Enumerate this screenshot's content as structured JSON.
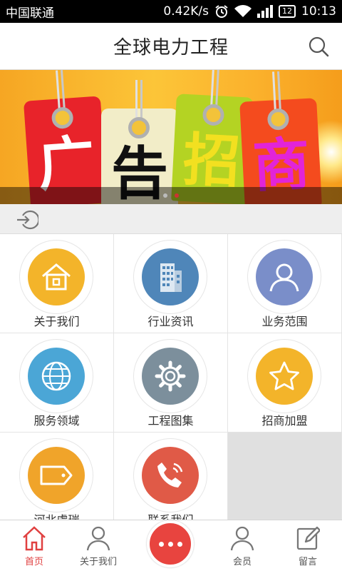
{
  "status_bar": {
    "carrier": "中国联通",
    "speed": "0.42K/s",
    "battery": "12",
    "time": "10:13"
  },
  "header": {
    "title": "全球电力工程",
    "search_icon": "search-icon"
  },
  "banner": {
    "tags": [
      {
        "char": "广",
        "bg": "#e8232a",
        "color": "#ffffff"
      },
      {
        "char": "告",
        "bg": "#f2edc8",
        "color": "#111111"
      },
      {
        "char": "招",
        "bg": "#b4d323",
        "color": "#f2e020"
      },
      {
        "char": "商",
        "bg": "#f44b1e",
        "color": "#e224d8"
      }
    ],
    "slide_count": 2,
    "active_slide": 2
  },
  "login_strip": {
    "icon": "login-icon"
  },
  "menu": [
    {
      "label": "关于我们",
      "icon": "home-icon",
      "color": "#f3b42a"
    },
    {
      "label": "行业资讯",
      "icon": "building-icon",
      "color": "#4f86b9"
    },
    {
      "label": "业务范围",
      "icon": "person-icon",
      "color": "#7a8ec9"
    },
    {
      "label": "服务领域",
      "icon": "globe-icon",
      "color": "#4ba6d6"
    },
    {
      "label": "工程图集",
      "icon": "gear-icon",
      "color": "#7c8f9c"
    },
    {
      "label": "招商加盟",
      "icon": "star-icon",
      "color": "#f3b42a"
    },
    {
      "label": "河北虞瑞",
      "icon": "tag-icon",
      "color": "#f0a42a"
    },
    {
      "label": "联系我们",
      "icon": "phone-icon",
      "color": "#e05a47"
    }
  ],
  "bottom_nav": {
    "home": "首页",
    "about": "关于我们",
    "member": "会员",
    "message": "留言"
  },
  "colors": {
    "accent": "#e8443f",
    "active_nav": "#e04040"
  }
}
